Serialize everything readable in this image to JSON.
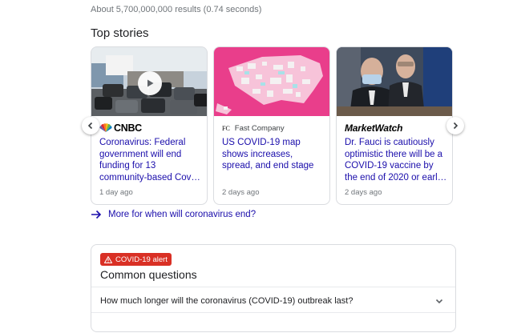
{
  "results_count": "About 5,700,000,000 results (0.74 seconds)",
  "top_stories": {
    "title": "Top stories",
    "cards": [
      {
        "source_name": "CNBC",
        "headline": "Coronavirus: Federal government will end funding for 13 community-based Cov…",
        "time": "1 day ago",
        "thumbnail": "video-thumbnail-drive-thru-testing"
      },
      {
        "source_icon_text": "FC",
        "source_name": "Fast Company",
        "headline": "US COVID-19 map shows increases, spread, and end stage",
        "time": "2 days ago",
        "thumbnail": "us-covid-map"
      },
      {
        "source_name": "MarketWatch",
        "headline": "Dr. Fauci is cautiously optimistic there will be a COVID-19 vaccine by the end of 2020 or earl…",
        "time": "2 days ago",
        "thumbnail": "hearing-photo"
      }
    ],
    "more_link": "More for when will coronavirus end?"
  },
  "common_questions": {
    "alert_label": "COVID-19 alert",
    "title": "Common questions",
    "questions": [
      "How much longer will the coronavirus (COVID-19) outbreak last?"
    ]
  },
  "colors": {
    "link": "#1a0dab",
    "alert": "#d93025",
    "marketwatch_green": "#217a3c"
  }
}
